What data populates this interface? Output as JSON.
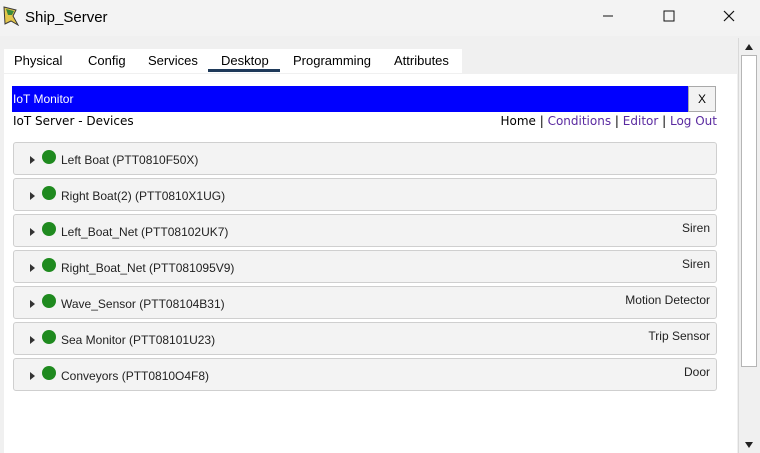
{
  "window": {
    "title": "Ship_Server",
    "icon": "packet-tracer-server-icon",
    "controls": [
      "minimize-icon",
      "maximize-icon",
      "close-icon"
    ]
  },
  "tabs": [
    {
      "label": "Physical"
    },
    {
      "label": "Config"
    },
    {
      "label": "Services"
    },
    {
      "label": "Desktop",
      "selected": true
    },
    {
      "label": "Programming"
    },
    {
      "label": "Attributes"
    }
  ],
  "monitor": {
    "title": "IoT Monitor",
    "close_label": "X",
    "subheader": "IoT Server - Devices",
    "nav": {
      "home": "Home",
      "conditions": "Conditions",
      "editor": "Editor",
      "logout": "Log Out",
      "separator": "|"
    },
    "accent_color": "#0000ff",
    "status_color": "#1f8a1f"
  },
  "devices": [
    {
      "name": "Left Boat (PTT0810F50X)",
      "type": ""
    },
    {
      "name": "Right Boat(2) (PTT0810X1UG)",
      "type": ""
    },
    {
      "name": "Left_Boat_Net (PTT08102UK7)",
      "type": "Siren"
    },
    {
      "name": "Right_Boat_Net (PTT081095V9)",
      "type": "Siren"
    },
    {
      "name": "Wave_Sensor (PTT08104B31)",
      "type": "Motion Detector"
    },
    {
      "name": "Sea Monitor (PTT08101U23)",
      "type": "Trip Sensor"
    },
    {
      "name": "Conveyors (PTT0810O4F8)",
      "type": "Door"
    }
  ]
}
